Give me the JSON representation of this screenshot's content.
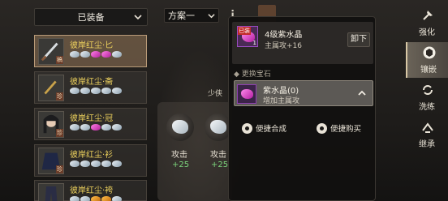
{
  "equipment_filter": {
    "selected": "已装备"
  },
  "items": [
    {
      "name": "彼岸红尘·匕",
      "tag": "稿",
      "gems": [
        "s",
        "s",
        "p",
        "p",
        "s"
      ],
      "selected": true
    },
    {
      "name": "彼岸红尘·斋",
      "tag": "珍",
      "gems": [
        "s",
        "s",
        "s",
        "s",
        "s"
      ],
      "selected": false
    },
    {
      "name": "彼岸红尘·冠",
      "tag": "珍",
      "gems": [
        "s",
        "s",
        "p",
        "s",
        "s"
      ],
      "selected": false
    },
    {
      "name": "彼岸红尘·衫",
      "tag": "珍",
      "gems": [
        "s",
        "s",
        "s",
        "s",
        "s"
      ],
      "selected": false
    },
    {
      "name": "彼岸红尘·袴",
      "tag": "",
      "gems": [
        "s",
        "s",
        "o",
        "o",
        "s"
      ],
      "selected": false
    }
  ],
  "scheme": {
    "selected": "方案一",
    "info_icon": "info-icon"
  },
  "side_label": "少侠",
  "slots": [
    {
      "stat": "攻击",
      "value": "+25"
    },
    {
      "stat": "攻击",
      "value": "+25"
    }
  ],
  "popup": {
    "equipped_badge": "已装",
    "count": "1",
    "title": "4级紫水晶",
    "subtitle": "主属攻+16",
    "unload_label": "卸下",
    "section_label": "更换宝石",
    "option": {
      "name": "紫水晶(0)",
      "desc": "增加主属攻"
    },
    "quick_synth": "便捷合成",
    "quick_buy": "便捷购买"
  },
  "nav": [
    {
      "label": "强化",
      "icon": "hammer-icon",
      "active": false
    },
    {
      "label": "镶嵌",
      "icon": "hexagon-icon",
      "active": true
    },
    {
      "label": "洗练",
      "icon": "recycle-icon",
      "active": false
    },
    {
      "label": "继承",
      "icon": "inherit-icon",
      "active": false
    }
  ],
  "colors": {
    "gold_text": "#f0d45e",
    "green_value": "#7bd37b",
    "purple_gem": "#b31da2"
  }
}
